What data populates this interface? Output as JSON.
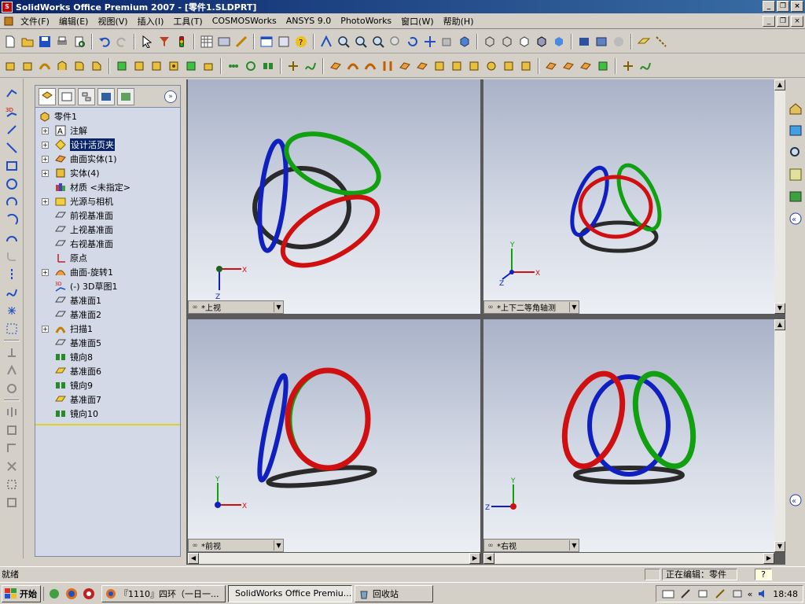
{
  "window": {
    "title": "SolidWorks Office Premium 2007 - [零件1.SLDPRT]"
  },
  "menubar": {
    "items": [
      "文件(F)",
      "编辑(E)",
      "视图(V)",
      "插入(I)",
      "工具(T)",
      "COSMOSWorks",
      "ANSYS 9.0",
      "PhotoWorks",
      "窗口(W)",
      "帮助(H)"
    ]
  },
  "feature_tree": {
    "root": "零件1",
    "items": [
      {
        "label": "注解",
        "icon": "annotation-icon",
        "expandable": true
      },
      {
        "label": "设计活页夹",
        "icon": "design-binder-icon",
        "expandable": true,
        "selected": true
      },
      {
        "label": "曲面实体(1)",
        "icon": "surface-body-icon",
        "expandable": true
      },
      {
        "label": "实体(4)",
        "icon": "solid-body-icon",
        "expandable": true
      },
      {
        "label": "材质 <未指定>",
        "icon": "material-icon",
        "expandable": false
      },
      {
        "label": "光源与相机",
        "icon": "lights-camera-icon",
        "expandable": true
      },
      {
        "label": "前视基准面",
        "icon": "plane-icon",
        "expandable": false
      },
      {
        "label": "上视基准面",
        "icon": "plane-icon",
        "expandable": false
      },
      {
        "label": "右视基准面",
        "icon": "plane-icon",
        "expandable": false
      },
      {
        "label": "原点",
        "icon": "origin-icon",
        "expandable": false
      },
      {
        "label": "曲面-旋转1",
        "icon": "revolve-surface-icon",
        "expandable": true
      },
      {
        "label": "(-) 3D草图1",
        "icon": "sketch3d-icon",
        "expandable": false
      },
      {
        "label": "基准面1",
        "icon": "plane-icon",
        "expandable": false
      },
      {
        "label": "基准面2",
        "icon": "plane-icon",
        "expandable": false
      },
      {
        "label": "扫描1",
        "icon": "sweep-icon",
        "expandable": true
      },
      {
        "label": "基准面5",
        "icon": "plane-icon",
        "expandable": false
      },
      {
        "label": "镜向8",
        "icon": "mirror-icon",
        "expandable": false
      },
      {
        "label": "基准面6",
        "icon": "plane-selected-icon",
        "expandable": false
      },
      {
        "label": "镜向9",
        "icon": "mirror-icon",
        "expandable": false
      },
      {
        "label": "基准面7",
        "icon": "plane-selected-icon",
        "expandable": false
      },
      {
        "label": "镜向10",
        "icon": "mirror-icon",
        "expandable": false
      }
    ]
  },
  "viewports": [
    {
      "id": "top",
      "label": "*上视",
      "axes": [
        "X",
        "Z"
      ]
    },
    {
      "id": "trimetric",
      "label": "*上下二等角轴测",
      "axes": [
        "X",
        "Y",
        "Z"
      ]
    },
    {
      "id": "front",
      "label": "*前视",
      "axes": [
        "X",
        "Y"
      ]
    },
    {
      "id": "right",
      "label": "*右视",
      "axes": [
        "Y",
        "Z"
      ]
    }
  ],
  "colors": {
    "ring_red": "#d01010",
    "ring_green": "#10a010",
    "ring_blue": "#1020c0",
    "ring_black": "#2a2a2a"
  },
  "statusbar": {
    "left": "就绪",
    "editing": "正在编辑：零件",
    "help": "?"
  },
  "taskbar": {
    "start": "开始",
    "items": [
      "『1110』四环（一日一...",
      "SolidWorks Office Premiu...",
      "回收站"
    ],
    "clock": "18:48"
  }
}
